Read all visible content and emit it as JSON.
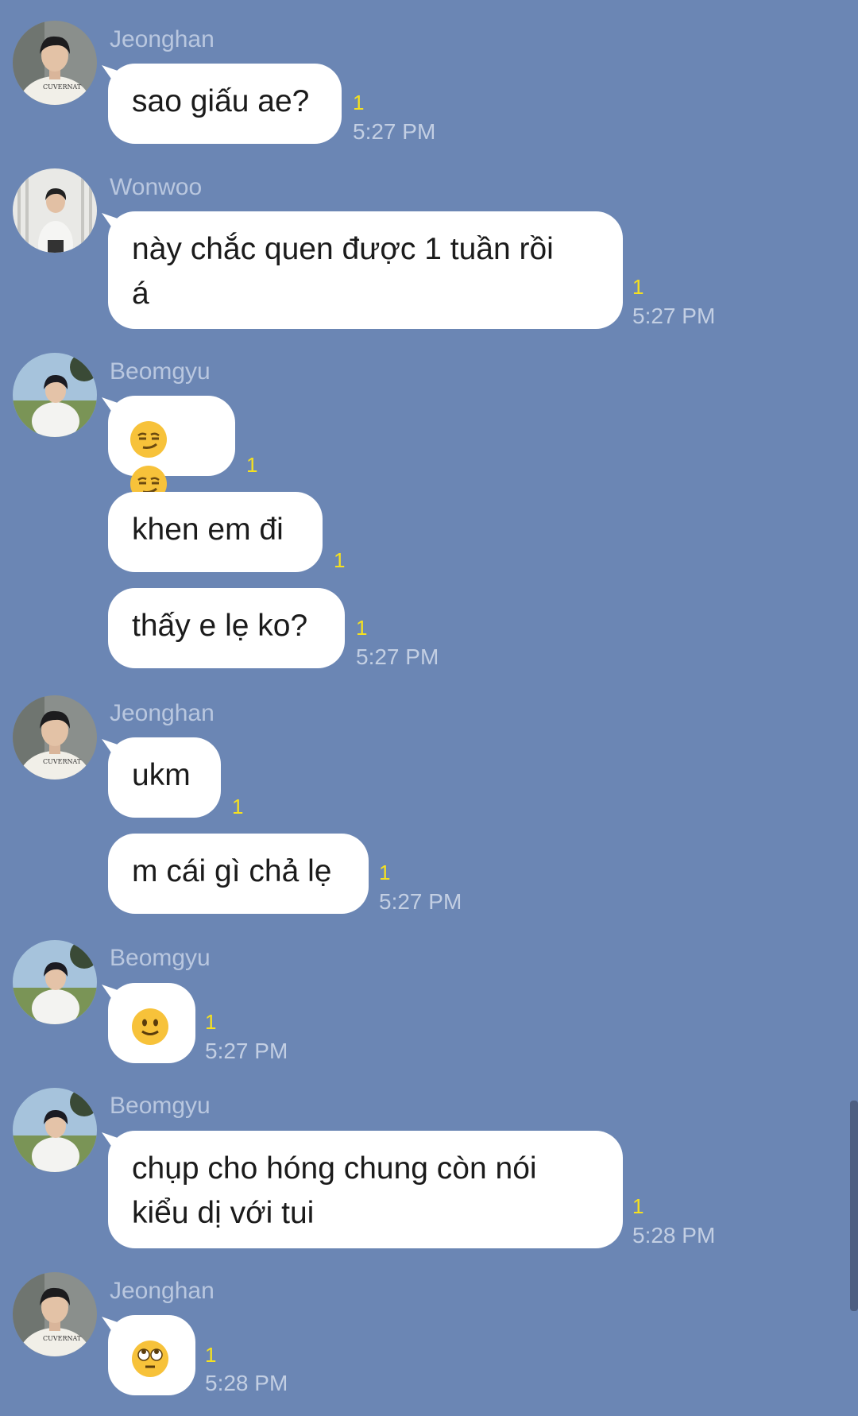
{
  "messages": [
    {
      "sender": "Jeonghan",
      "text": "sao giấu ae?",
      "unread": "1",
      "time": "5:27 PM"
    },
    {
      "sender": "Wonwoo",
      "text_line1": "này chắc quen được 1 tuần rồi",
      "text_line2": "á",
      "unread": "1",
      "time": "5:27 PM"
    },
    {
      "sender": "Beomgyu",
      "emoji": "smirking-face-x2",
      "unread": "1"
    },
    {
      "text": "khen em đi",
      "unread": "1"
    },
    {
      "text": "thấy e lẹ ko?",
      "unread": "1",
      "time": "5:27 PM"
    },
    {
      "sender": "Jeonghan",
      "text": "ukm",
      "unread": "1"
    },
    {
      "text": "m cái gì chả lẹ",
      "unread": "1",
      "time": "5:27 PM"
    },
    {
      "sender": "Beomgyu",
      "emoji": "slightly-smiling-face",
      "unread": "1",
      "time": "5:27 PM"
    },
    {
      "sender": "Beomgyu",
      "text_line1": "chụp cho hóng chung còn nói",
      "text_line2": "kiểu dị với tui",
      "unread": "1",
      "time": "5:28 PM"
    },
    {
      "sender": "Jeonghan",
      "emoji": "face-with-rolling-eyes",
      "unread": "1",
      "time": "5:28 PM"
    }
  ],
  "colors": {
    "background": "#6b86b4",
    "bubble": "#ffffff",
    "unread": "#f6e11f",
    "time": "#c3cfe3",
    "sender": "#b9c7df"
  }
}
